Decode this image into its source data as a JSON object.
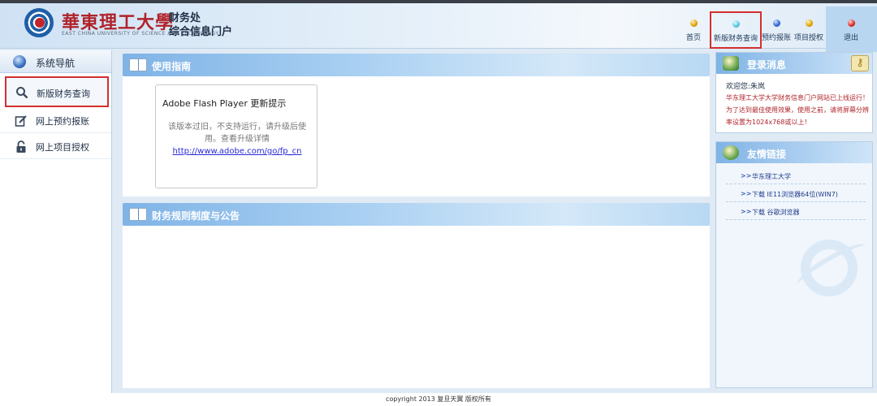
{
  "header": {
    "logo_cn": "華東理工大學",
    "logo_en": "EAST CHINA UNIVERSITY OF SCIENCE AND TECHNOLOGY",
    "dept_line1": "财务处",
    "dept_line2": "综合信息门户"
  },
  "topnav": {
    "items": [
      {
        "label": "首页",
        "icon": "orange-ball-icon"
      },
      {
        "label": "新版财务查询",
        "icon": "teal-ball-icon",
        "selected": true
      },
      {
        "label": "预约报账",
        "icon": "blue-ball-icon"
      },
      {
        "label": "项目授权",
        "icon": "orange-ball-icon"
      },
      {
        "label": "退出",
        "icon": "red-ball-icon"
      }
    ]
  },
  "sidebar": {
    "title": "系统导航",
    "items": [
      {
        "label": "新版财务查询",
        "icon": "search-icon",
        "selected": true
      },
      {
        "label": "网上预约报账",
        "icon": "edit-icon"
      },
      {
        "label": "网上项目授权",
        "icon": "lock-icon"
      }
    ]
  },
  "main": {
    "guide_title": "使用指南",
    "flash": {
      "title": "Adobe Flash Player 更新提示",
      "message": "该版本过旧，不支持运行，请升级后使用。查看升级详情",
      "link": "http://www.adobe.com/go/fp_cn"
    },
    "rules_title": "财务规则制度与公告"
  },
  "right": {
    "login_title": "登录消息",
    "welcome": "欢迎您:朱岚",
    "notice": "华东理工大学大学财务信息门户网站已上线运行！为了达到最佳使用效果，使用之前，请将屏幕分辨率设置为1024x768或以上！",
    "links_title": "友情链接",
    "links": [
      {
        "arrow": ">>",
        "label": "华东理工大学"
      },
      {
        "arrow": ">>",
        "label": "下载 IE11浏览器64位(WIN7)"
      },
      {
        "arrow": ">>",
        "label": "下载 谷歌浏览器"
      }
    ]
  },
  "footer": {
    "text": "copyright 2013 复旦天翼 版权所有"
  },
  "colors": {
    "accent_red": "#d32f2f",
    "brand_red": "#b0232a",
    "header_blue": "#7fb3e6"
  }
}
